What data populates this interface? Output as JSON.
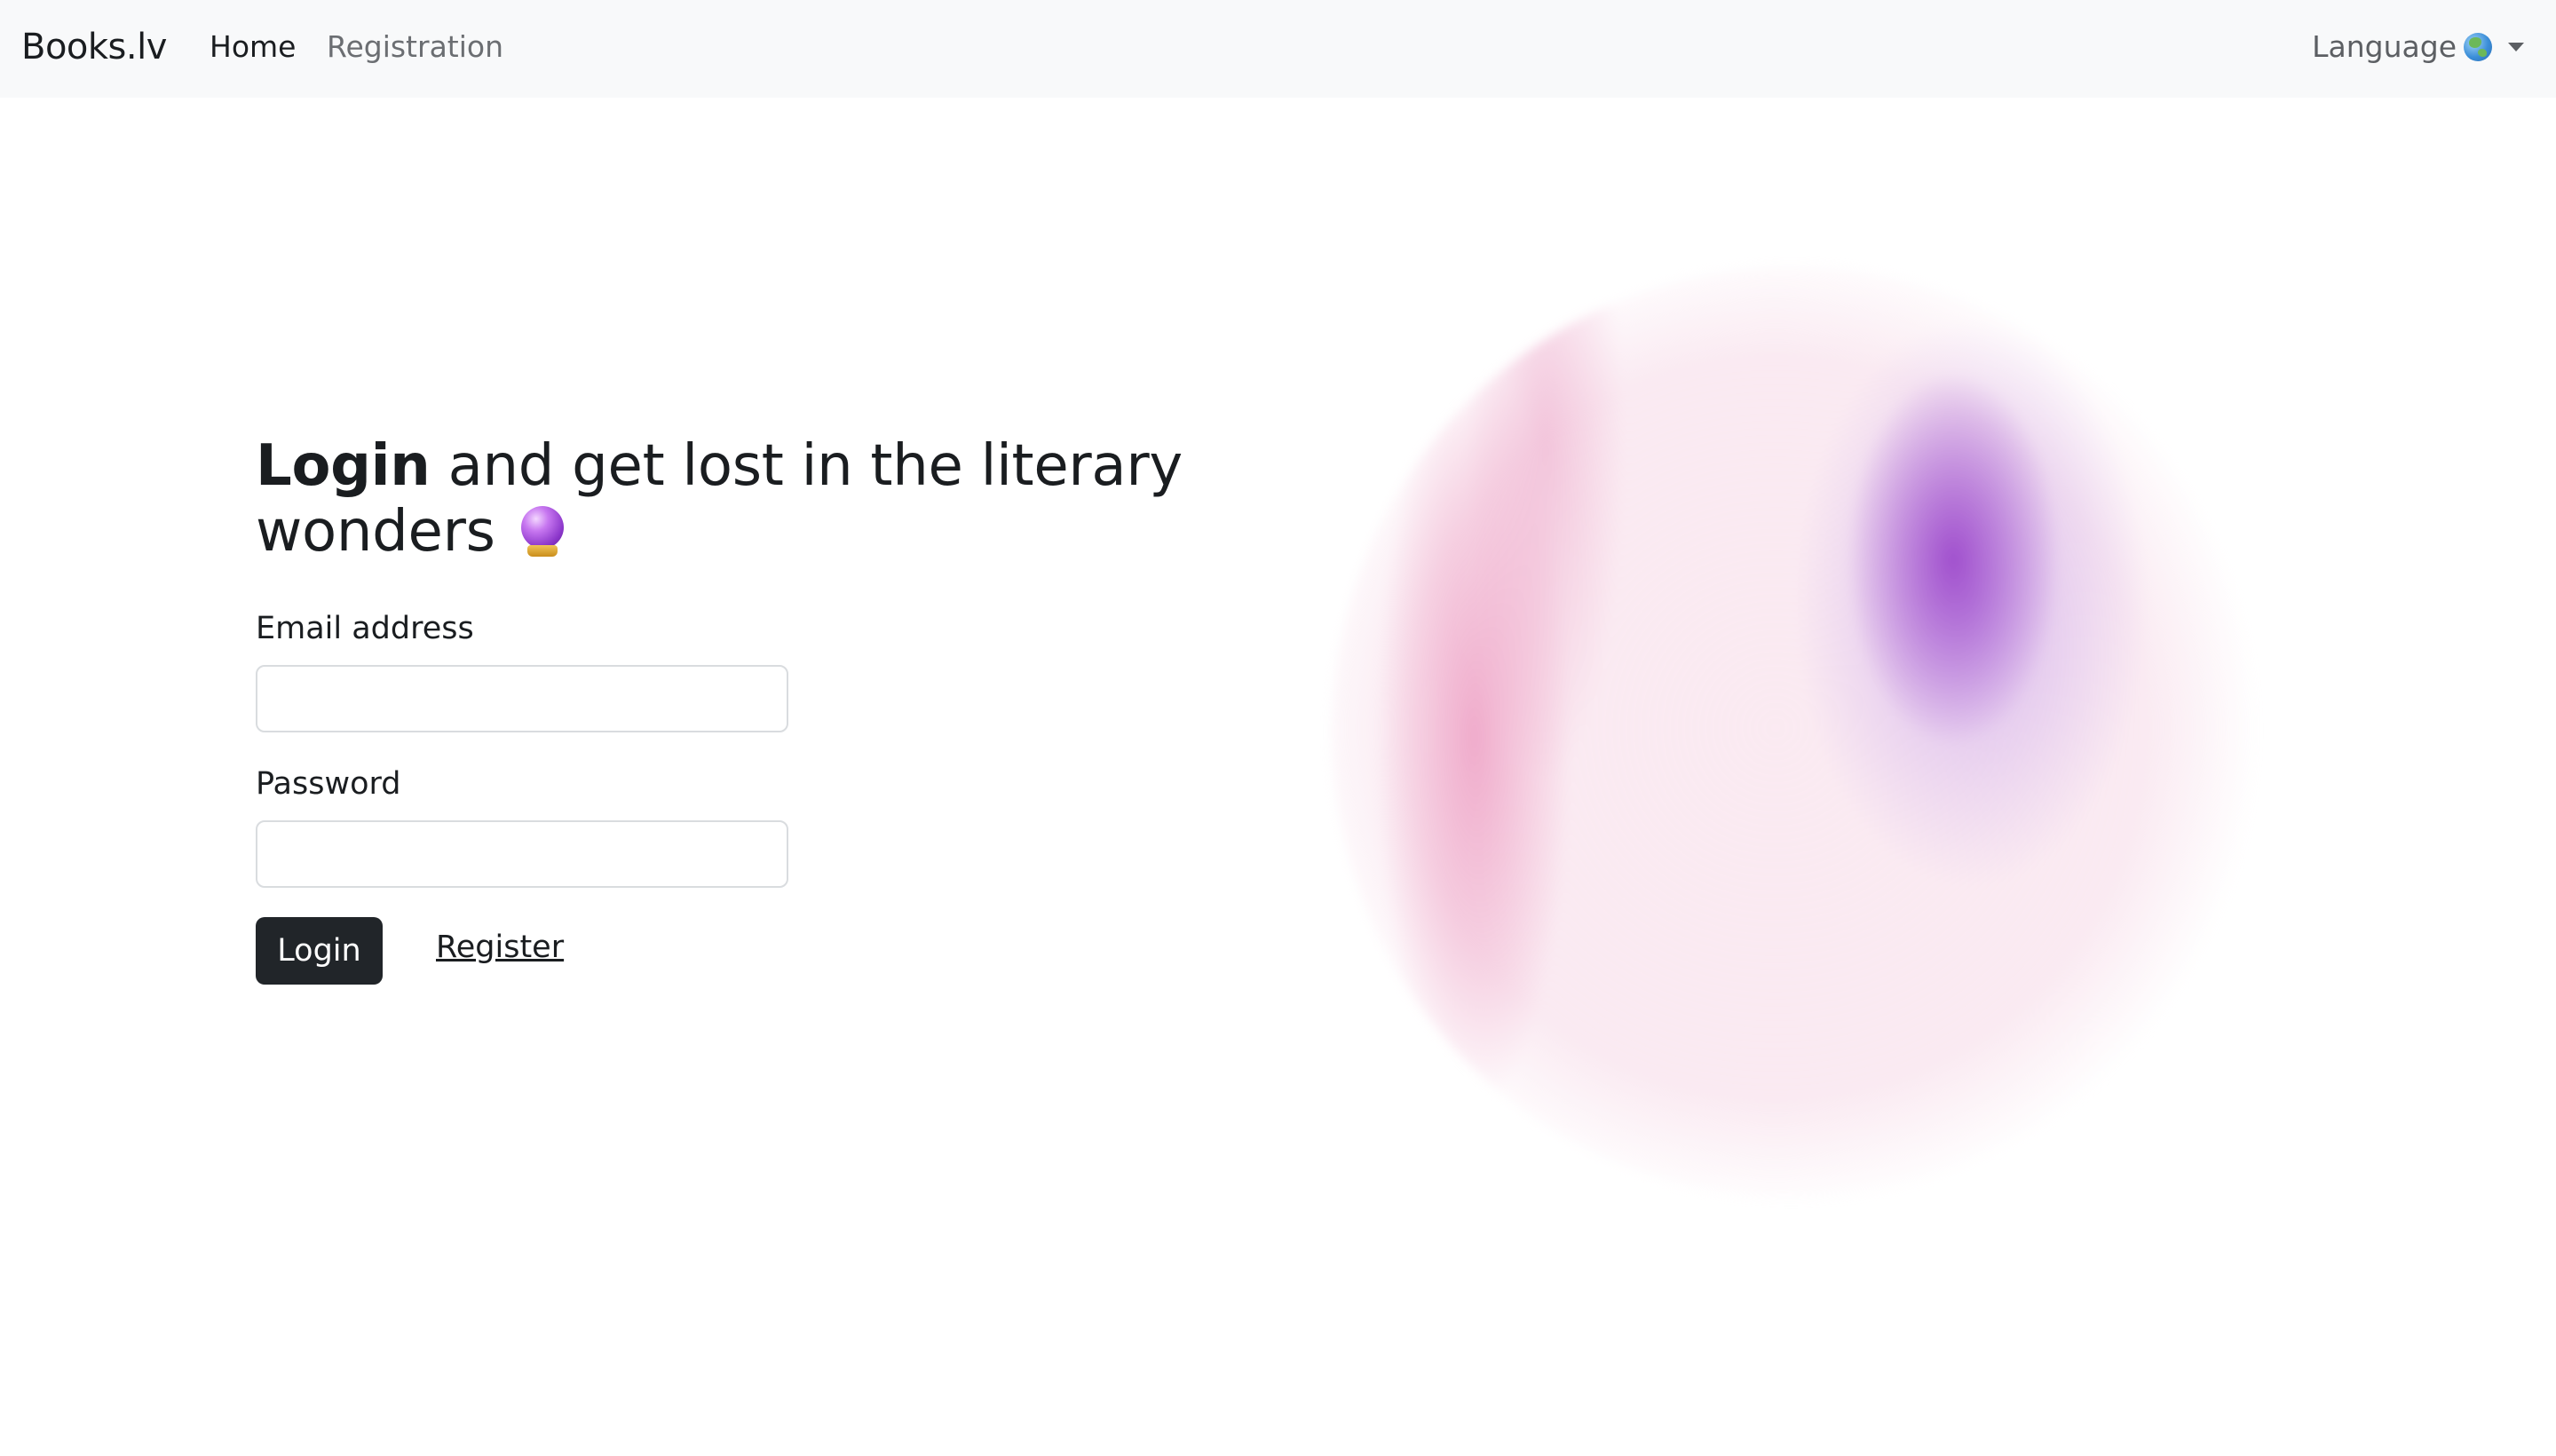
{
  "navbar": {
    "brand": "Books.lv",
    "links": [
      {
        "label": "Home"
      },
      {
        "label": "Registration"
      }
    ],
    "language_label": "Language",
    "language_icon": "globe-icon"
  },
  "hero": {
    "title_bold": "Login",
    "title_rest": " and get lost in the literary wonders ",
    "title_icon": "crystal-ball-icon"
  },
  "form": {
    "email_label": "Email address",
    "email_value": "",
    "password_label": "Password",
    "password_value": "",
    "login_button": "Login",
    "register_link": "Register"
  },
  "colors": {
    "navbar_bg": "#f8f9fa",
    "button_bg": "#212529",
    "button_text": "#ffffff"
  }
}
